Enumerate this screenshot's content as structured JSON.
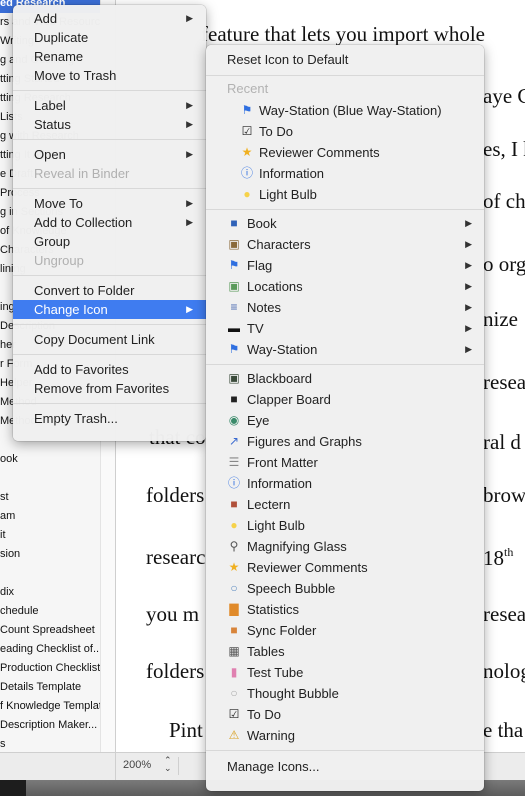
{
  "binder": {
    "rows": [
      {
        "label": "ed Research",
        "selected": true
      },
      {
        "label": "rs and Web Resources"
      },
      {
        "label": "Writing"
      },
      {
        "label": "g and Outlining"
      },
      {
        "label": "tting Started"
      },
      {
        "label": "tting Research"
      },
      {
        "label": "Lists"
      },
      {
        "label": "g with Research"
      },
      {
        "label": "tting It All"
      },
      {
        "label": "e Draft"
      },
      {
        "label": "Process"
      },
      {
        "label": "g in Sections"
      },
      {
        "label": "of Knowledge"
      },
      {
        "label": "Characters"
      },
      {
        "label": "lining"
      },
      {
        "label": ""
      },
      {
        "label": "ing"
      },
      {
        "label": "Description"
      },
      {
        "label": "her"
      },
      {
        "label": "r Form"
      },
      {
        "label": "Helper"
      },
      {
        "label": "Method"
      },
      {
        "label": "Method"
      },
      {
        "label": ""
      },
      {
        "label": "ook"
      },
      {
        "label": ""
      },
      {
        "label": "st"
      },
      {
        "label": "am"
      },
      {
        "label": "it"
      },
      {
        "label": "sion"
      },
      {
        "label": ""
      },
      {
        "label": "dix"
      },
      {
        "label": "chedule"
      },
      {
        "label": "Count Spreadsheet"
      },
      {
        "label": "eading Checklist of..."
      },
      {
        "label": "Production Checklist"
      },
      {
        "label": "Details Template"
      },
      {
        "label": "f Knowledge Template"
      },
      {
        "label": "Description Maker..."
      },
      {
        "label": "s"
      }
    ]
  },
  "editor": {
    "lines": [
      {
        "text": "feature that lets you import whole"
      },
      {
        "text": "aye C"
      },
      {
        "text": "es, I h"
      },
      {
        "text": "of ch"
      },
      {
        "text": "o org"
      },
      {
        "text": "nize"
      },
      {
        "text": "resea"
      },
      {
        "text": "that co"
      },
      {
        "text": "ral d"
      },
      {
        "text": "folders"
      },
      {
        "text": "brow"
      },
      {
        "text": "researc"
      },
      {
        "text": "18",
        "sup": "th"
      },
      {
        "text": "you m"
      },
      {
        "text": "resea"
      },
      {
        "text": "folders"
      },
      {
        "text": "nolog"
      },
      {
        "text": "Pint"
      },
      {
        "text": "e tha"
      }
    ],
    "zoom_level": "200%"
  },
  "context_menu": {
    "items": [
      {
        "label": "Add",
        "submenu": true
      },
      {
        "label": "Duplicate"
      },
      {
        "label": "Rename"
      },
      {
        "label": "Move to Trash"
      },
      {
        "separator": true
      },
      {
        "label": "Label",
        "submenu": true
      },
      {
        "label": "Status",
        "submenu": true
      },
      {
        "separator": true
      },
      {
        "label": "Open",
        "submenu": true
      },
      {
        "label": "Reveal in Binder",
        "disabled": true
      },
      {
        "separator": true
      },
      {
        "label": "Move To",
        "submenu": true
      },
      {
        "label": "Add to Collection",
        "submenu": true
      },
      {
        "label": "Group"
      },
      {
        "label": "Ungroup",
        "disabled": true
      },
      {
        "separator": true
      },
      {
        "label": "Convert to Folder"
      },
      {
        "label": "Change Icon",
        "submenu": true,
        "highlighted": true
      },
      {
        "separator": true
      },
      {
        "label": "Copy Document Link"
      },
      {
        "separator": true
      },
      {
        "label": "Add to Favorites"
      },
      {
        "label": "Remove from Favorites"
      },
      {
        "separator": true
      },
      {
        "label": "Empty Trash..."
      }
    ]
  },
  "icon_submenu": {
    "reset_label": "Reset Icon to Default",
    "recent_header": "Recent",
    "recent": [
      {
        "label": "Way-Station (Blue Way-Station)",
        "icon": "blue-flag-icon"
      },
      {
        "label": "To Do",
        "icon": "checkbox-icon"
      },
      {
        "label": "Reviewer Comments",
        "icon": "star-icon"
      },
      {
        "label": "Information",
        "icon": "info-icon"
      },
      {
        "label": "Light Bulb",
        "icon": "light-bulb-icon"
      }
    ],
    "groups": [
      {
        "label": "Book",
        "icon": "book-icon"
      },
      {
        "label": "Characters",
        "icon": "character-card-icon"
      },
      {
        "label": "Flag",
        "icon": "flag-icon"
      },
      {
        "label": "Locations",
        "icon": "location-card-icon"
      },
      {
        "label": "Notes",
        "icon": "notepad-icon"
      },
      {
        "label": "TV",
        "icon": "tv-icon"
      },
      {
        "label": "Way-Station",
        "icon": "way-station-flag-icon"
      }
    ],
    "icons": [
      {
        "label": "Blackboard",
        "icon": "blackboard-icon"
      },
      {
        "label": "Clapper Board",
        "icon": "clapper-board-icon"
      },
      {
        "label": "Eye",
        "icon": "eye-icon"
      },
      {
        "label": "Figures and Graphs",
        "icon": "graph-icon"
      },
      {
        "label": "Front Matter",
        "icon": "front-matter-icon"
      },
      {
        "label": "Information",
        "icon": "info-icon"
      },
      {
        "label": "Lectern",
        "icon": "lectern-icon"
      },
      {
        "label": "Light Bulb",
        "icon": "light-bulb-icon"
      },
      {
        "label": "Magnifying Glass",
        "icon": "magnifying-glass-icon"
      },
      {
        "label": "Reviewer Comments",
        "icon": "star-icon"
      },
      {
        "label": "Speech Bubble",
        "icon": "speech-bubble-icon"
      },
      {
        "label": "Statistics",
        "icon": "statistics-icon"
      },
      {
        "label": "Sync Folder",
        "icon": "sync-folder-icon"
      },
      {
        "label": "Tables",
        "icon": "table-icon"
      },
      {
        "label": "Test Tube",
        "icon": "test-tube-icon"
      },
      {
        "label": "Thought Bubble",
        "icon": "thought-bubble-icon"
      },
      {
        "label": "To Do",
        "icon": "checkbox-icon"
      },
      {
        "label": "Warning",
        "icon": "warning-icon"
      }
    ],
    "manage_label": "Manage Icons..."
  },
  "colors": {
    "highlight": "#3f7cf0",
    "binder_selection": "#3b6fd8"
  }
}
